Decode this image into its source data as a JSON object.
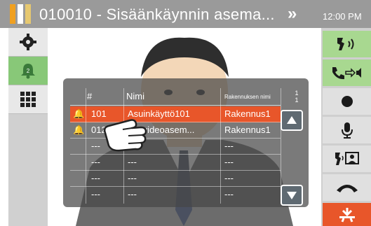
{
  "header": {
    "title": "010010 - Sisäänkäynnin asema...",
    "time": "12:00 PM"
  },
  "sidebar_left": {
    "items": [
      {
        "icon": "gear-icon"
      },
      {
        "icon": "bell-icon",
        "badge": "2"
      },
      {
        "icon": "grid-icon"
      }
    ]
  },
  "table": {
    "headers": [
      "#",
      "Nimi",
      "Rakennuksen nimi"
    ],
    "page_label": "1\n1",
    "rows": [
      {
        "number": "101",
        "name": "Asuinkäyttö101",
        "building": "Rakennus1",
        "selected": true
      },
      {
        "number": "012",
        "name": "...n videoasem...",
        "building": "Rakennus1",
        "selected": false
      },
      {
        "number": "---",
        "name": "---",
        "building": "---",
        "selected": false
      },
      {
        "number": "---",
        "name": "---",
        "building": "---",
        "selected": false
      },
      {
        "number": "---",
        "name": "---",
        "building": "---",
        "selected": false
      },
      {
        "number": "---",
        "name": "---",
        "building": "---",
        "selected": false
      }
    ]
  },
  "colors": {
    "accent_green": "#88c878",
    "selected_row": "#e8562a",
    "topbar": "#9a9a9a"
  }
}
